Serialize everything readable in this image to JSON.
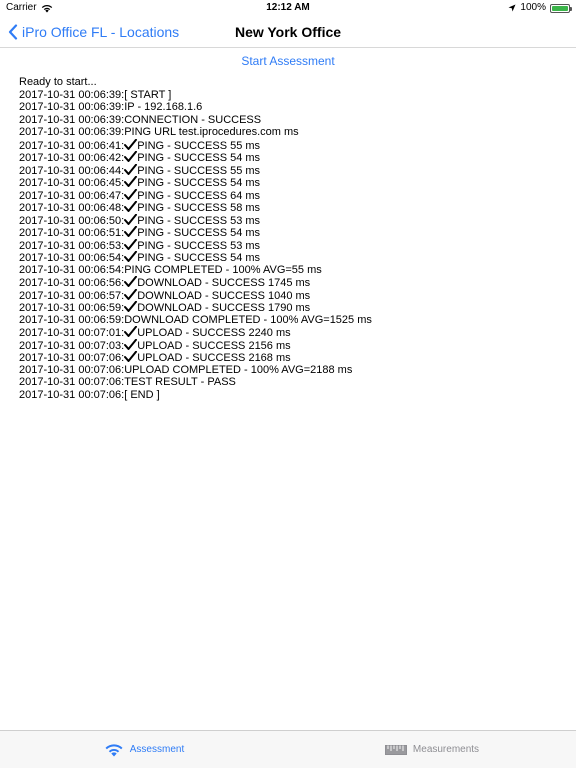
{
  "status_bar": {
    "carrier": "Carrier",
    "time": "12:12 AM",
    "battery": "100%",
    "battery_color": "#3bb54a"
  },
  "nav": {
    "back_label": "iPro Office FL - Locations",
    "title": "New York Office",
    "accent_color": "#2f7cf6"
  },
  "start_button_label": "Start Assessment",
  "log": {
    "header": "Ready to start...",
    "lines": [
      {
        "ts": "2017-10-31 00:06:39:",
        "check": false,
        "text": "[ START ]"
      },
      {
        "ts": "2017-10-31 00:06:39:",
        "check": false,
        "text": "IP - 192.168.1.6"
      },
      {
        "ts": "2017-10-31 00:06:39:",
        "check": false,
        "text": "CONNECTION - SUCCESS"
      },
      {
        "ts": "2017-10-31 00:06:39:",
        "check": false,
        "text": "PING URL test.iprocedures.com ms"
      },
      {
        "ts": "2017-10-31 00:06:41:",
        "check": true,
        "text": "PING - SUCCESS 55 ms"
      },
      {
        "ts": "2017-10-31 00:06:42:",
        "check": true,
        "text": "PING - SUCCESS 54 ms"
      },
      {
        "ts": "2017-10-31 00:06:44:",
        "check": true,
        "text": "PING - SUCCESS 55 ms"
      },
      {
        "ts": "2017-10-31 00:06:45:",
        "check": true,
        "text": "PING - SUCCESS 54 ms"
      },
      {
        "ts": "2017-10-31 00:06:47:",
        "check": true,
        "text": "PING - SUCCESS 64 ms"
      },
      {
        "ts": "2017-10-31 00:06:48:",
        "check": true,
        "text": "PING - SUCCESS 58 ms"
      },
      {
        "ts": "2017-10-31 00:06:50:",
        "check": true,
        "text": "PING - SUCCESS 53 ms"
      },
      {
        "ts": "2017-10-31 00:06:51:",
        "check": true,
        "text": "PING - SUCCESS 54 ms"
      },
      {
        "ts": "2017-10-31 00:06:53:",
        "check": true,
        "text": "PING - SUCCESS 53 ms"
      },
      {
        "ts": "2017-10-31 00:06:54:",
        "check": true,
        "text": "PING - SUCCESS 54 ms"
      },
      {
        "ts": "2017-10-31 00:06:54:",
        "check": false,
        "text": "PING COMPLETED - 100% AVG=55 ms"
      },
      {
        "ts": "2017-10-31 00:06:56:",
        "check": true,
        "text": "DOWNLOAD - SUCCESS 1745 ms"
      },
      {
        "ts": "2017-10-31 00:06:57:",
        "check": true,
        "text": "DOWNLOAD - SUCCESS 1040 ms"
      },
      {
        "ts": "2017-10-31 00:06:59:",
        "check": true,
        "text": "DOWNLOAD - SUCCESS 1790 ms"
      },
      {
        "ts": "2017-10-31 00:06:59:",
        "check": false,
        "text": "DOWNLOAD COMPLETED - 100% AVG=1525 ms"
      },
      {
        "ts": "2017-10-31 00:07:01:",
        "check": true,
        "text": "UPLOAD - SUCCESS 2240 ms"
      },
      {
        "ts": "2017-10-31 00:07:03:",
        "check": true,
        "text": "UPLOAD - SUCCESS 2156 ms"
      },
      {
        "ts": "2017-10-31 00:07:06:",
        "check": true,
        "text": "UPLOAD - SUCCESS 2168 ms"
      },
      {
        "ts": "2017-10-31 00:07:06:",
        "check": false,
        "text": "UPLOAD COMPLETED - 100% AVG=2188 ms"
      },
      {
        "ts": "2017-10-31 00:07:06:",
        "check": false,
        "text": "TEST RESULT - PASS"
      },
      {
        "ts": "2017-10-31 00:07:06:",
        "check": false,
        "text": "[ END ]"
      }
    ]
  },
  "tabs": [
    {
      "label": "Assessment",
      "icon": "wifi-icon",
      "selected": true
    },
    {
      "label": "Measurements",
      "icon": "ruler-icon",
      "selected": false
    }
  ]
}
